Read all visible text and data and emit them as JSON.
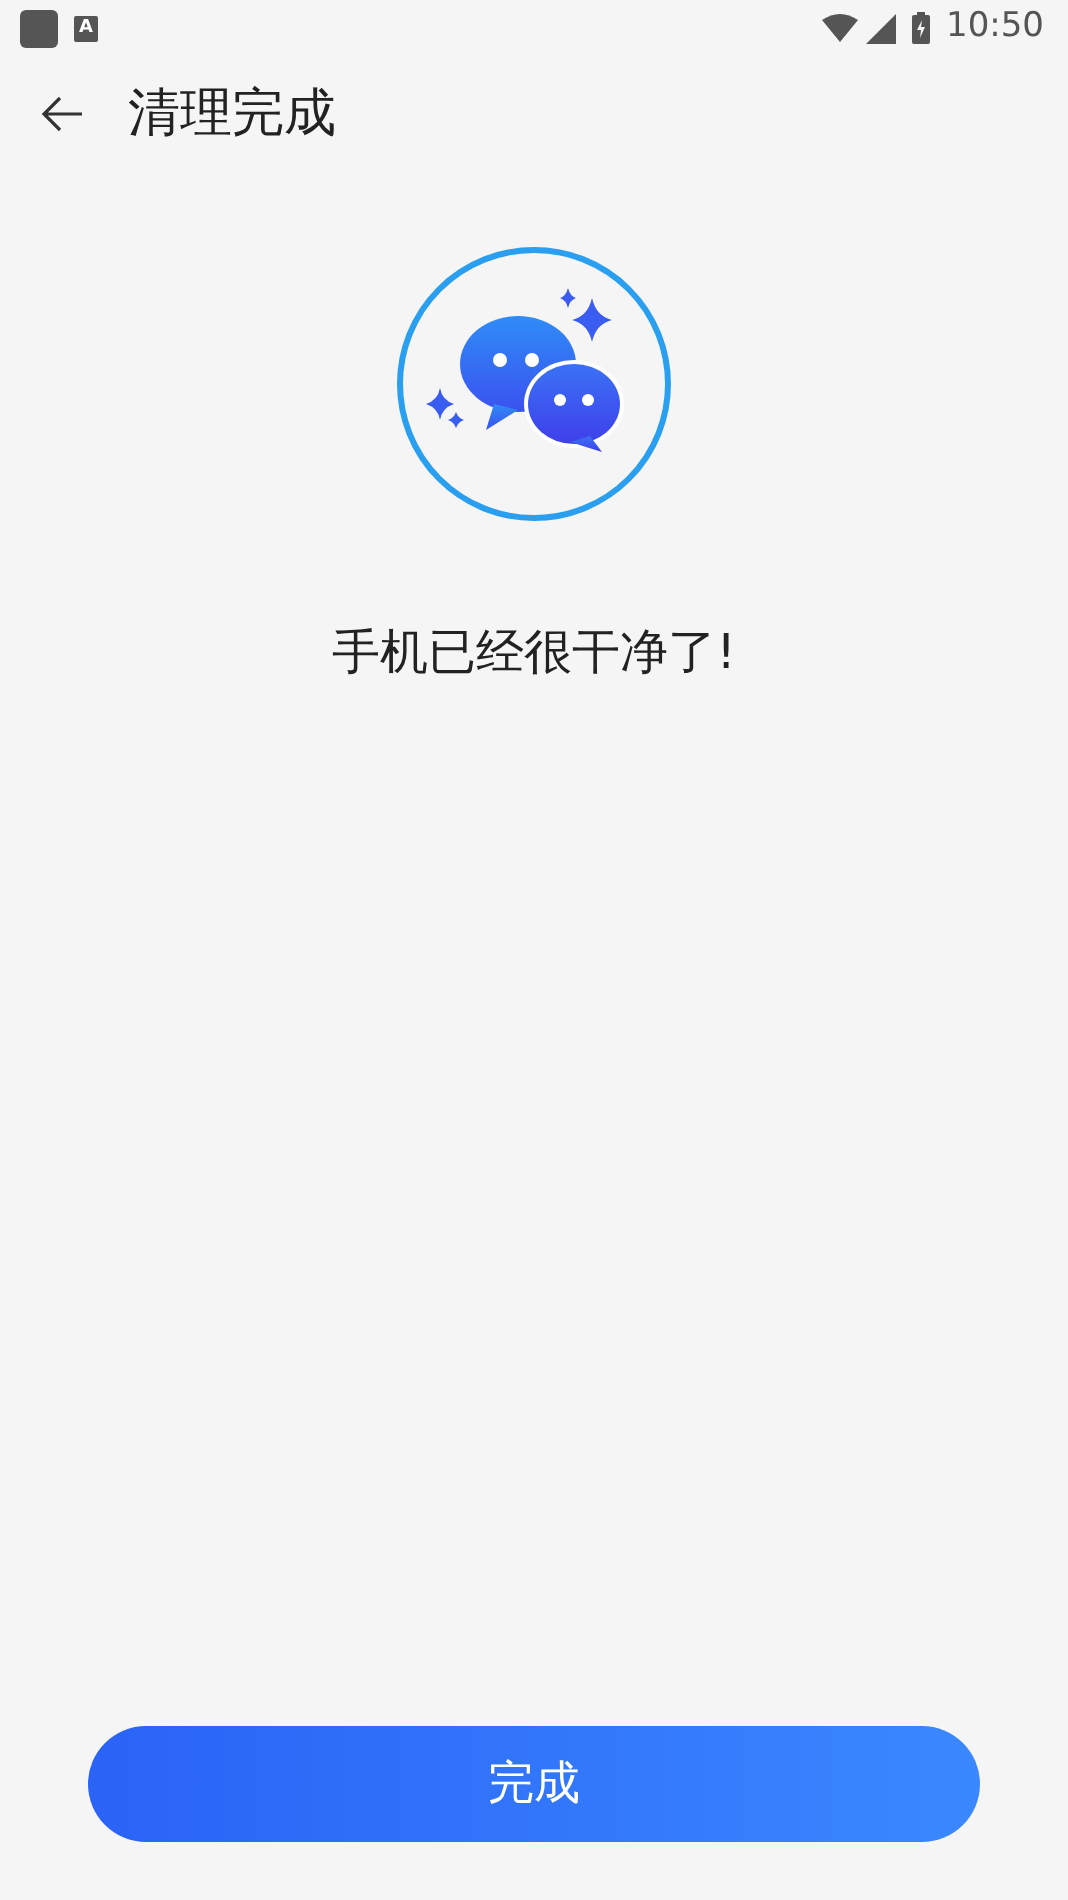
{
  "status_bar": {
    "notification": "A",
    "time": "10:50"
  },
  "toolbar": {
    "title": "清理完成"
  },
  "message": "手机已经很干净了!",
  "done_button": {
    "label": "完成"
  }
}
